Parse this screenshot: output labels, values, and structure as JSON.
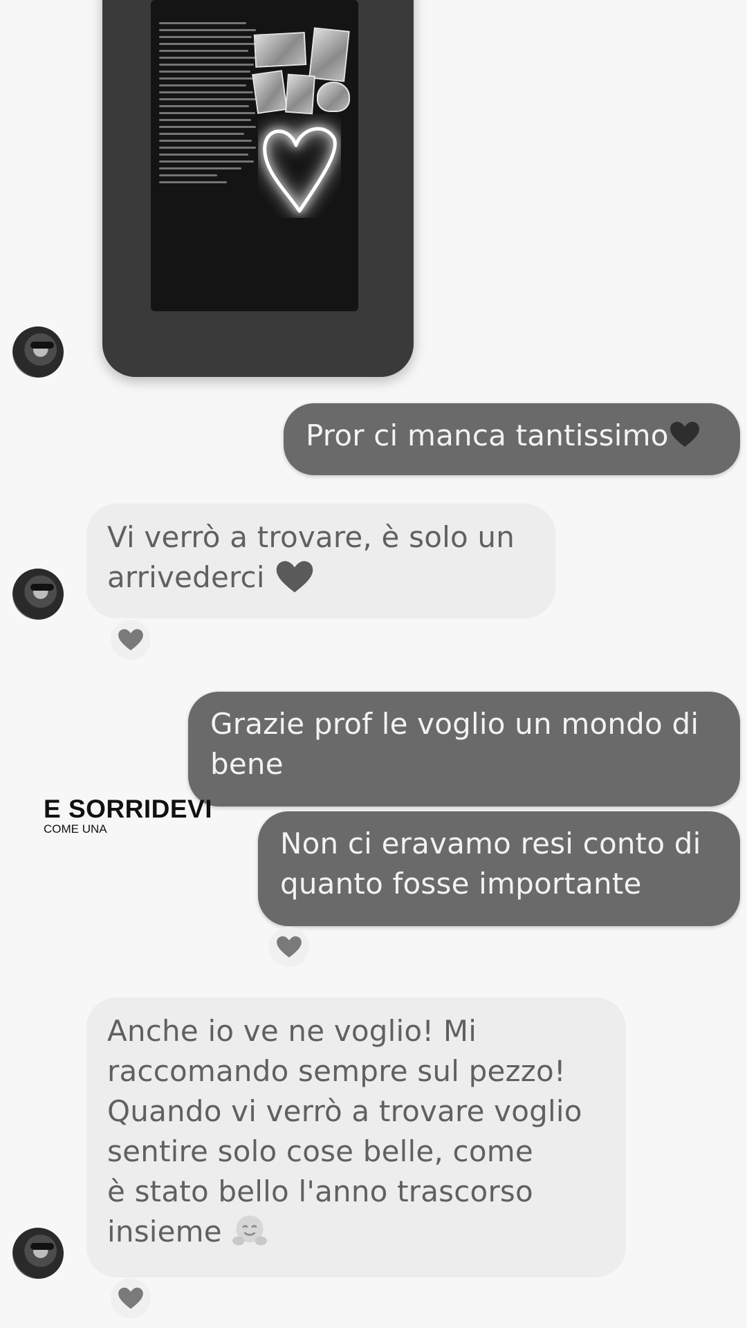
{
  "colors": {
    "background": "#f7f7f7",
    "outgoing_bubble": "#6a6a6a",
    "incoming_bubble": "#ededed"
  },
  "messages": [
    {
      "direction": "out",
      "text": "Pror ci manca tantissimo",
      "emoji": "heart-icon"
    },
    {
      "direction": "in",
      "text_line1": "Vi verrò a trovare, è solo un",
      "text_line2": "arrivederci",
      "emoji": "heart-icon",
      "reaction": "heart-icon"
    },
    {
      "direction": "out",
      "text_line1": "Grazie prof le voglio un mondo di",
      "text_line2": "bene"
    },
    {
      "direction": "out",
      "text_line1": "Non ci eravamo resi conto di",
      "text_line2": "quanto fosse importante",
      "reaction": "heart-icon"
    },
    {
      "direction": "in",
      "lines": [
        "Anche io ve ne voglio! Mi",
        "raccomando sempre sul pezzo!",
        "Quando vi verrò a trovare voglio",
        "sentire solo cose belle, come",
        "è stato bello l'anno trascorso",
        "insieme"
      ],
      "emoji": "hugging-face-icon",
      "reaction": "heart-icon"
    }
  ],
  "overlay": {
    "title": "E SORRIDEVI",
    "subtitle": "COME UNA"
  }
}
